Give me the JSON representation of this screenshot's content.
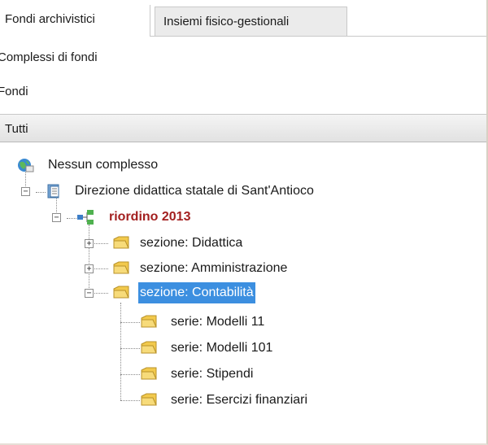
{
  "tabs": {
    "active_label": "Fondi archivistici",
    "inactive_label": "Insiemi fisico-gestionali"
  },
  "nav": {
    "complessi_label": "Complessi di fondi",
    "fondi_label": "Fondi"
  },
  "group_header": {
    "label": "Tutti"
  },
  "tree": {
    "root": {
      "label": "Nessun complesso",
      "icon": "globe-icon"
    },
    "fondo": {
      "label": "Direzione didattica statale di Sant'Antioco",
      "icon": "document-book-icon"
    },
    "riordino": {
      "label": "riordino 2013",
      "icon": "hierarchy-icon"
    },
    "sezioni": [
      {
        "label": "sezione: Didattica",
        "state": "collapsed"
      },
      {
        "label": "sezione: Amministrazione",
        "state": "collapsed"
      },
      {
        "label": "sezione: Contabilità",
        "state": "expanded-selected"
      }
    ],
    "serie": [
      {
        "label": "serie: Modelli 11"
      },
      {
        "label": "serie: Modelli 101"
      },
      {
        "label": "serie: Stipendi"
      },
      {
        "label": "serie: Esercizi finanziari"
      }
    ]
  },
  "colors": {
    "selection_bg": "#3c8fe0",
    "bold_node": "#a32020",
    "folder": "#f2c94c"
  }
}
